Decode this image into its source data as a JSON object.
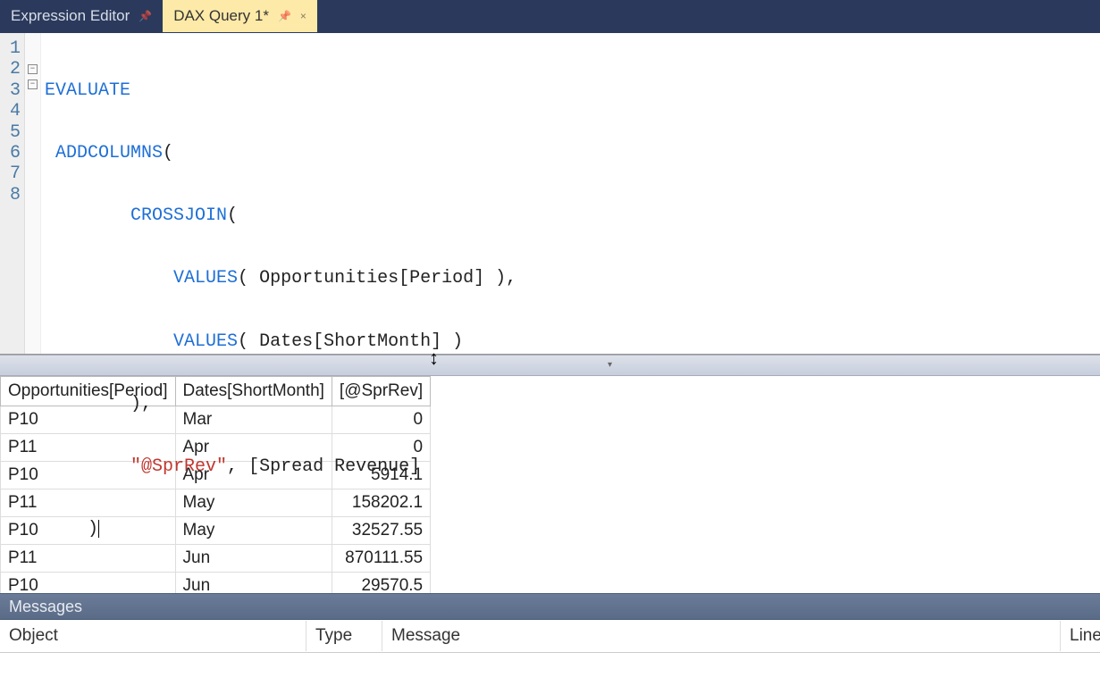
{
  "tabs": {
    "expression_editor": {
      "label": "Expression Editor",
      "pin_glyph": "📌"
    },
    "dax_query": {
      "label": "DAX Query 1*",
      "pin_glyph": "📌",
      "close_glyph": "×"
    }
  },
  "gutter": [
    "1",
    "2",
    "3",
    "4",
    "5",
    "6",
    "7",
    "8"
  ],
  "code": {
    "l1_kw": "EVALUATE",
    "l2_fn": "ADDCOLUMNS",
    "l2_pn": "(",
    "l3_fn": "CROSSJOIN",
    "l3_pn": "(",
    "l4_fn": "VALUES",
    "l4_pn1": "(",
    "l4_id": " Opportunities[Period] ",
    "l4_pn2": "),",
    "l5_fn": "VALUES",
    "l5_pn1": "(",
    "l5_id": " Dates[ShortMonth] ",
    "l5_pn2": ")",
    "l6_pn": "),",
    "l7_str": "\"@SprRev\"",
    "l7_pn1": ", ",
    "l7_id": "[Spread Revenue]",
    "l8_pn": ")"
  },
  "results": {
    "headers": [
      "Opportunities[Period]",
      "Dates[ShortMonth]",
      "[@SprRev]"
    ],
    "rows": [
      {
        "period": "P10",
        "month": "Mar",
        "val": "0"
      },
      {
        "period": "P11",
        "month": "Apr",
        "val": "0"
      },
      {
        "period": "P10",
        "month": "Apr",
        "val": "5914.1"
      },
      {
        "period": "P11",
        "month": "May",
        "val": "158202.1"
      },
      {
        "period": "P10",
        "month": "May",
        "val": "32527.55"
      },
      {
        "period": "P11",
        "month": "Jun",
        "val": "870111.55"
      },
      {
        "period": "P10",
        "month": "Jun",
        "val": "29570.5"
      }
    ]
  },
  "messages": {
    "title": "Messages",
    "cols": {
      "object": "Object",
      "type": "Type",
      "message": "Message",
      "line": "Line"
    }
  },
  "splitter": {
    "icon": "↕",
    "dropdown": "▾"
  }
}
